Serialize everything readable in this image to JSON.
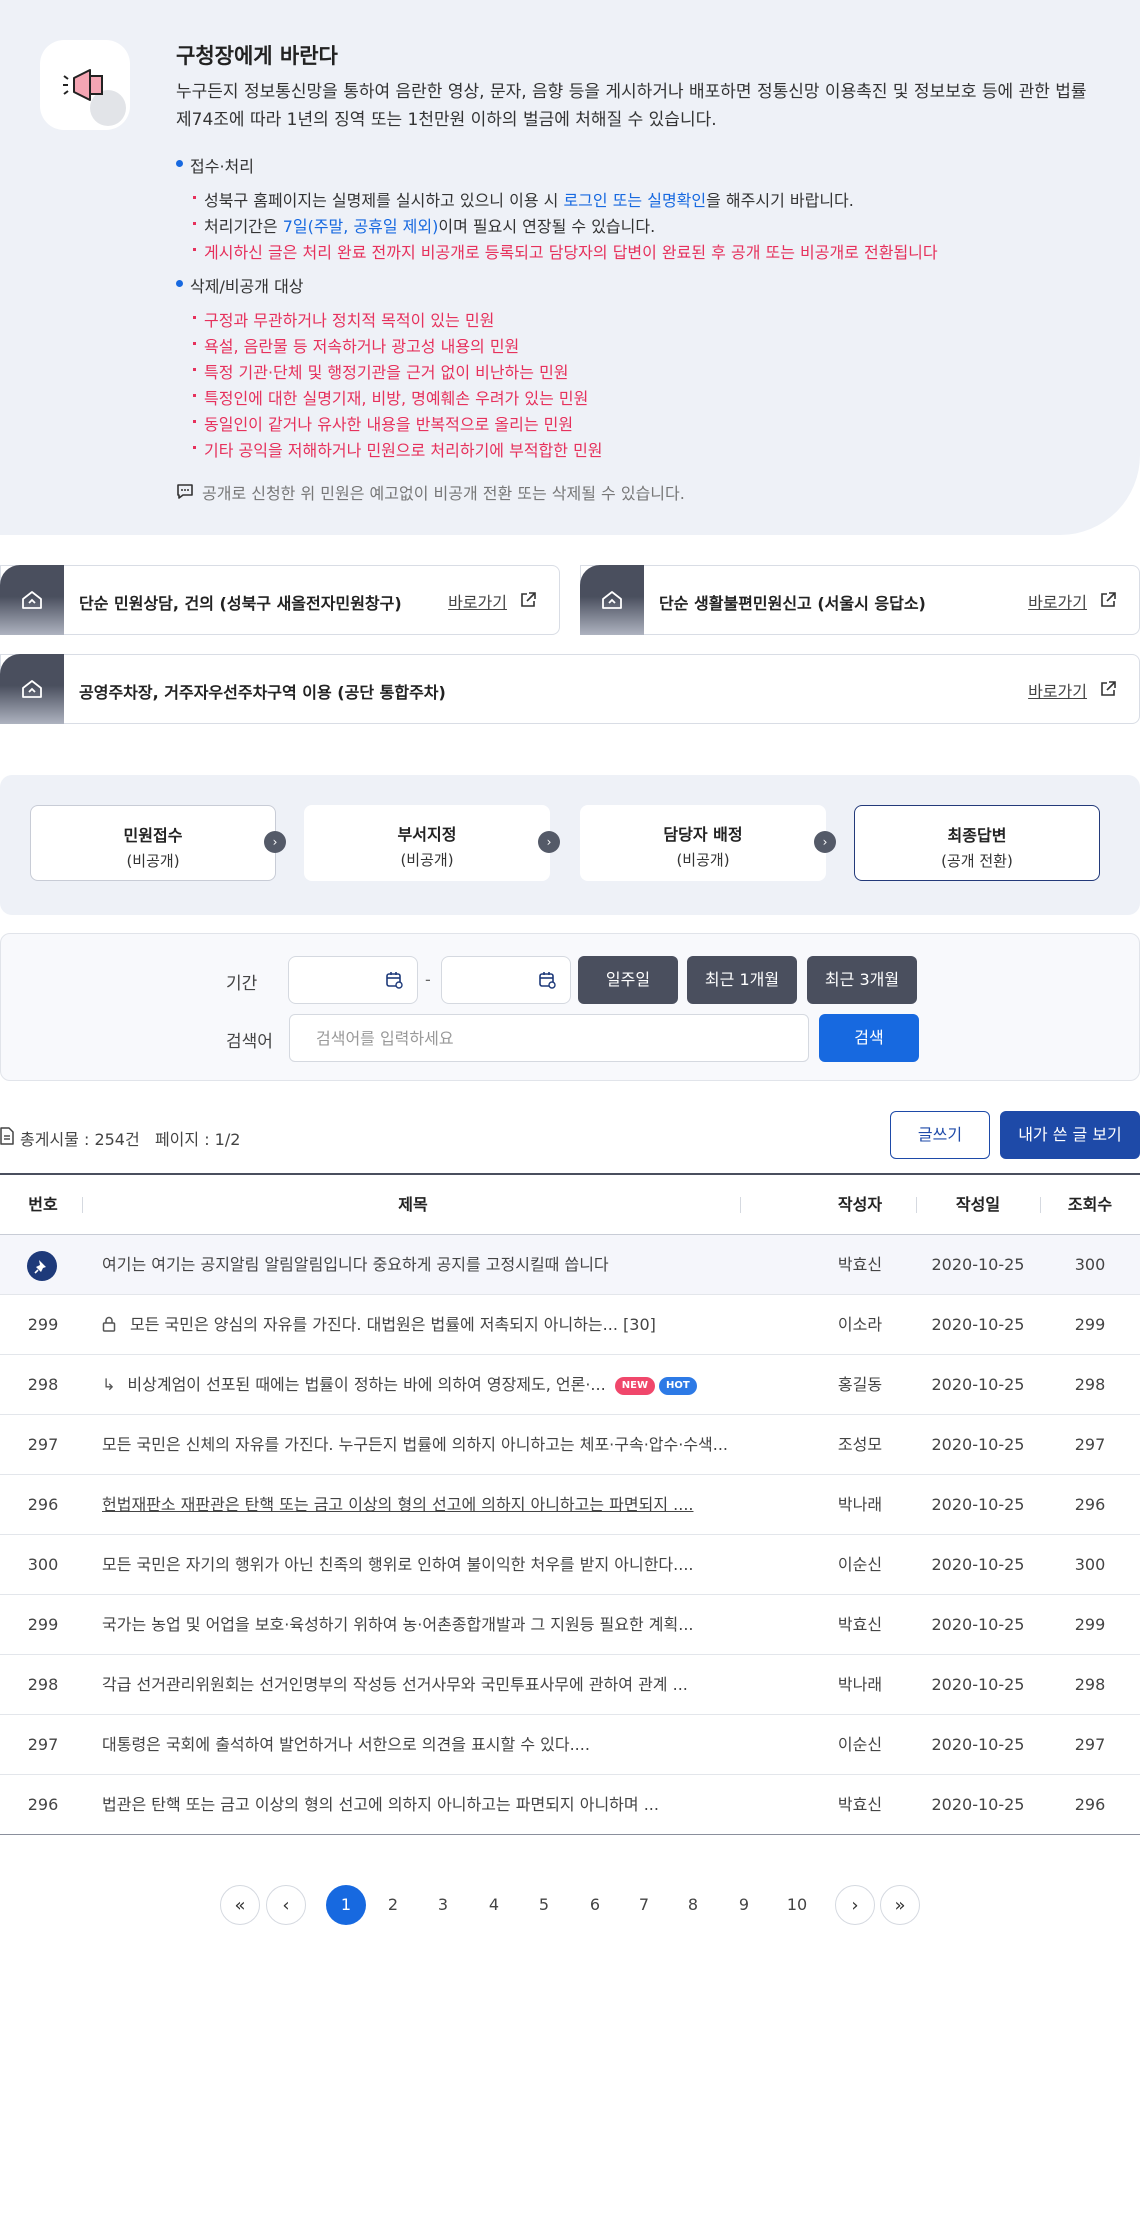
{
  "notice": {
    "title": "구청장에게 바란다",
    "desc": "누구든지 정보통신망을 통하여 음란한 영상, 문자, 음향 등을 게시하거나 배포하면 정통신망 이용촉진 및 정보보호 등에 관한 법률 제74조에 따라 1년의 징역 또는 1천만원 이하의 벌금에 처해질 수 있습니다.",
    "section1": {
      "head": "접수·처리",
      "b1_pre": "성북구 홈페이지는 실명제를 실시하고 있으니 이용 시 ",
      "b1_link": "로그인 또는 실명확인",
      "b1_post": "을 해주시기 바랍니다.",
      "b2_pre": "처리기간은 ",
      "b2_hl": "7일(주말, 공휴일 제외)",
      "b2_post": "이며 필요시 연장될 수 있습니다.",
      "b3": "게시하신 글은 처리 완료 전까지 비공개로 등록되고 담당자의 답변이 완료된 후 공개 또는 비공개로 전환됩니다"
    },
    "section2": {
      "head": "삭제/비공개 대상",
      "items": [
        "구정과 무관하거나 정치적 목적이 있는 민원",
        "욕설, 음란물 등 저속하거나 광고성 내용의 민원",
        "특정 기관·단체 및 행정기관을 근거 없이 비난하는 민원",
        "특정인에 대한 실명기재, 비방, 명예훼손 우려가 있는 민원",
        "동일인이 같거나 유사한 내용을 반복적으로 올리는 민원",
        "기타 공익을 저해하거나 민원으로 처리하기에 부적합한 민원"
      ]
    },
    "footnote": "공개로 신청한 위 민원은 예고없이 비공개 전환 또는 삭제될 수 있습니다."
  },
  "shortcuts": [
    {
      "title": "단순 민원상담, 건의 (성북구 새올전자민원창구)",
      "link": "바로가기"
    },
    {
      "title": "단순 생활불편민원신고 (서울시 응답소)",
      "link": "바로가기"
    },
    {
      "title": "공영주차장, 거주자우선주차구역 이용 (공단 통합주차)",
      "link": "바로가기"
    }
  ],
  "steps": [
    {
      "name": "민원접수",
      "status": "(비공개)"
    },
    {
      "name": "부서지정",
      "status": "(비공개)"
    },
    {
      "name": "담당자 배정",
      "status": "(비공개)"
    },
    {
      "name": "최종답변",
      "status": "(공개 전환)"
    }
  ],
  "search": {
    "period_label": "기간",
    "date_sep": "-",
    "btn_week": "일주일",
    "btn_1m": "최근 1개월",
    "btn_3m": "최근 3개월",
    "keyword_label": "검색어",
    "placeholder": "검색어를 입력하세요",
    "submit": "검색"
  },
  "board": {
    "summary": "총게시물 : 254건   페이지 : 1/2",
    "write_btn": "글쓰기",
    "mine_btn": "내가 쓴 글 보기",
    "headers": {
      "no": "번호",
      "title": "제목",
      "author": "작성자",
      "date": "작성일",
      "views": "조회수"
    },
    "rows": [
      {
        "no": "",
        "title": "여기는 여기는 공지알림 알림알림입니다 중요하게 공지를 고정시킬때 씁니다",
        "author": "박효신",
        "date": "2020-10-25",
        "views": "300",
        "pinned": true
      },
      {
        "no": "299",
        "title": "모든 국민은 양심의 자유를 가진다. 대법원은 법률에 저촉되지 아니하는...",
        "comments": "[30]",
        "author": "이소라",
        "date": "2020-10-25",
        "views": "299",
        "locked": true
      },
      {
        "no": "298",
        "title": "비상계엄이 선포된 때에는 법률이 정하는 바에 의하여 영장제도, 언론·...",
        "author": "홍길동",
        "date": "2020-10-25",
        "views": "298",
        "reply": true,
        "tag_new": "NEW",
        "tag_hot": "HOT"
      },
      {
        "no": "297",
        "title": "모든 국민은 신체의 자유를 가진다. 누구든지 법률에 의하지 아니하고는 체포·구속·압수·수색...",
        "author": "조성모",
        "date": "2020-10-25",
        "views": "297"
      },
      {
        "no": "296",
        "title": "헌법재판소 재판관은 탄핵 또는 금고 이상의 형의 선고에 의하지 아니하고는 파면되지 ....",
        "author": "박나래",
        "date": "2020-10-25",
        "views": "296",
        "underline": true
      },
      {
        "no": "300",
        "title": "모든 국민은 자기의 행위가 아닌 친족의 행위로 인하여 불이익한 처우를 받지 아니한다....",
        "author": "이순신",
        "date": "2020-10-25",
        "views": "300"
      },
      {
        "no": "299",
        "title": "국가는 농업 및 어업을 보호·육성하기 위하여 농·어촌종합개발과 그 지원등 필요한 계획...",
        "author": "박효신",
        "date": "2020-10-25",
        "views": "299"
      },
      {
        "no": "298",
        "title": "각급 선거관리위원회는 선거인명부의 작성등 선거사무와 국민투표사무에 관하여 관계 ...",
        "author": "박나래",
        "date": "2020-10-25",
        "views": "298"
      },
      {
        "no": "297",
        "title": "대통령은 국회에 출석하여 발언하거나 서한으로 의견을 표시할 수 있다....",
        "author": "이순신",
        "date": "2020-10-25",
        "views": "297"
      },
      {
        "no": "296",
        "title": "법관은 탄핵 또는 금고 이상의 형의 선고에 의하지 아니하고는 파면되지 아니하며  ...",
        "author": "박효신",
        "date": "2020-10-25",
        "views": "296"
      }
    ]
  },
  "pagination": {
    "first": "«",
    "prev": "‹",
    "pages": [
      "1",
      "2",
      "3",
      "4",
      "5",
      "6",
      "7",
      "8",
      "9",
      "10"
    ],
    "current": "1",
    "next": "›",
    "last": "»"
  },
  "colors": {
    "accent_blue": "#1769e0",
    "navy": "#1e4aa8",
    "alert_red": "#e6315c",
    "panel_bg": "#eef1f7",
    "dark_button": "#4a4f5e"
  }
}
